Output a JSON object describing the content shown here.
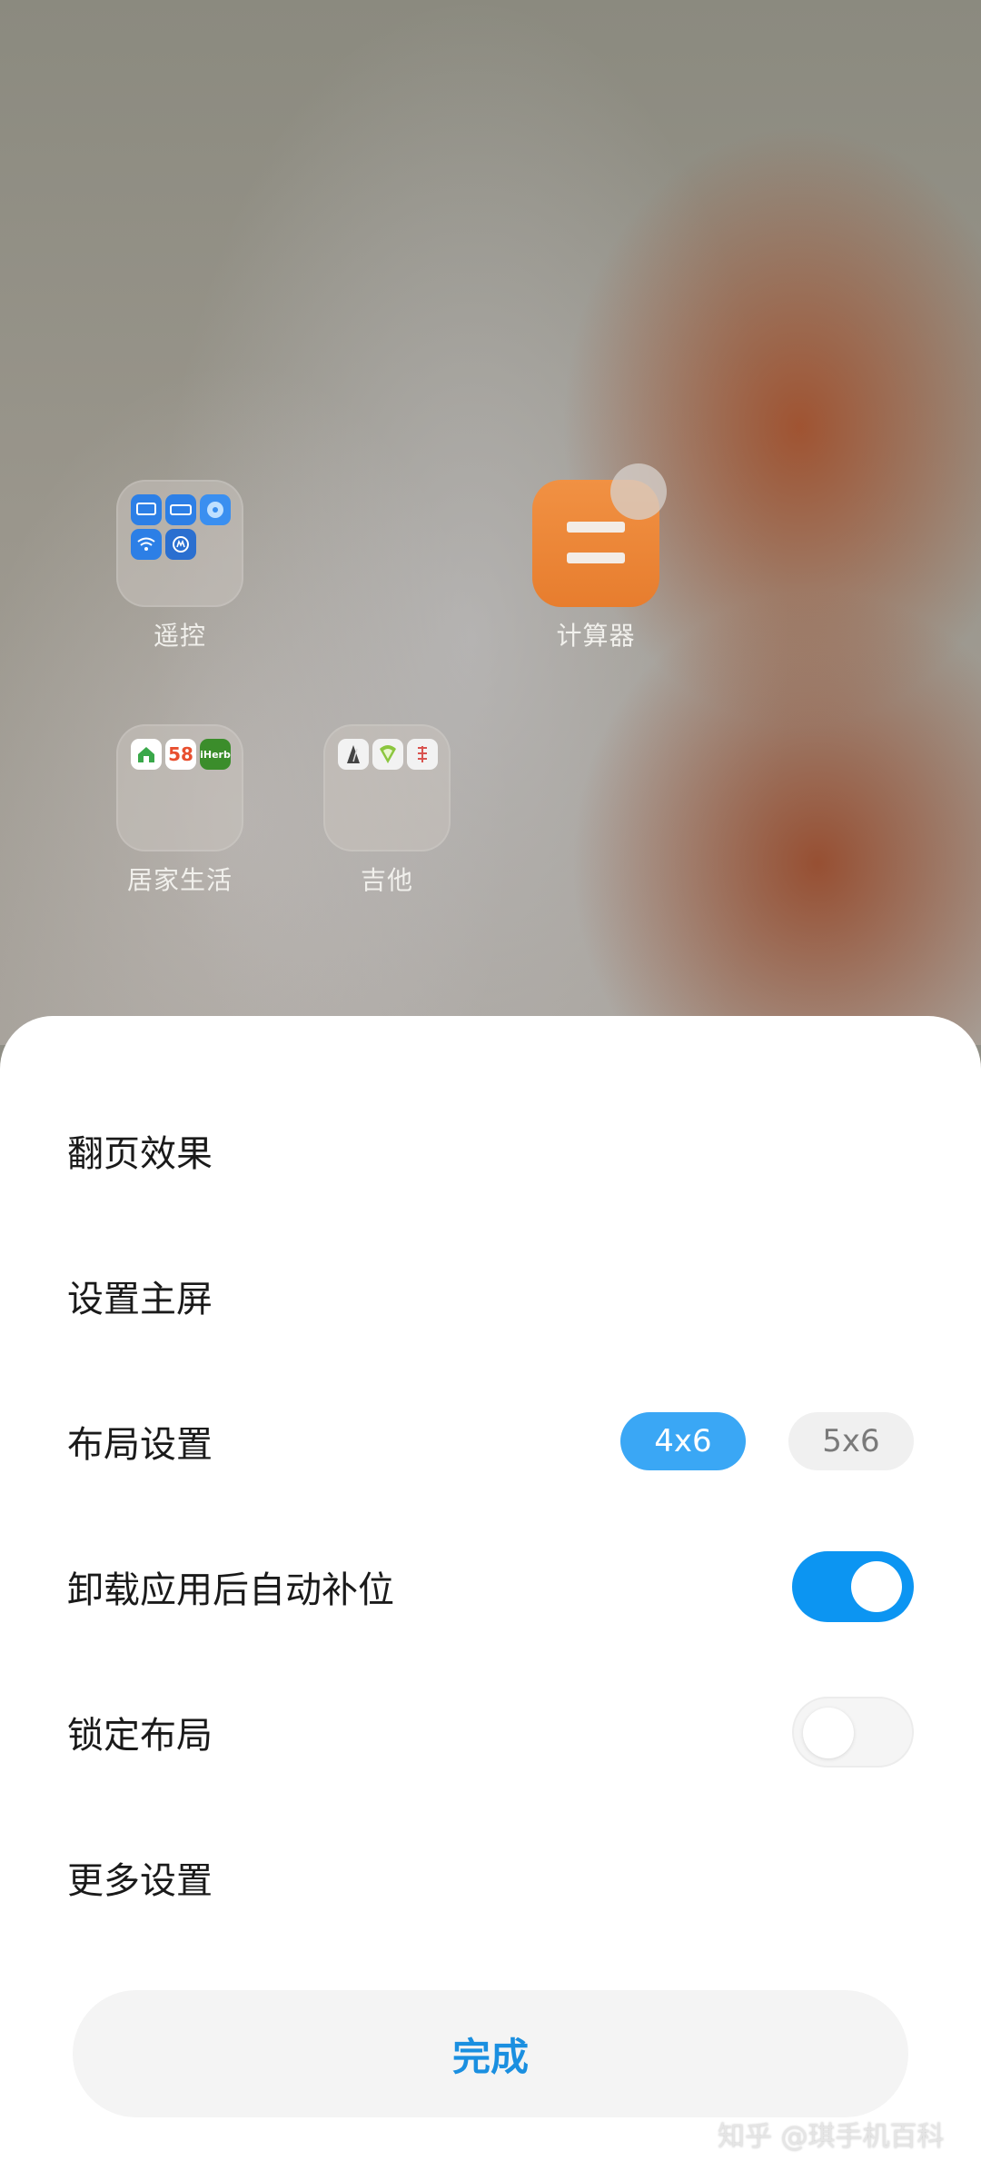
{
  "home": {
    "icons": [
      {
        "label": "遥控"
      },
      {
        "label": "计算器"
      },
      {
        "label": "居家生活"
      },
      {
        "label": "吉他"
      }
    ],
    "mini_58": "58",
    "mini_iherb": "iHerb"
  },
  "sheet": {
    "rows": [
      {
        "label": "翻页效果"
      },
      {
        "label": "设置主屏"
      },
      {
        "label": "布局设置"
      },
      {
        "label": "卸载应用后自动补位"
      },
      {
        "label": "锁定布局"
      },
      {
        "label": "更多设置"
      }
    ],
    "layout_options": [
      {
        "label": "4x6",
        "selected": true
      },
      {
        "label": "5x6",
        "selected": false
      }
    ],
    "auto_fill_enabled": true,
    "lock_layout_enabled": false,
    "done_label": "完成"
  },
  "watermark": "知乎 @琪手机百科",
  "colors": {
    "accent": "#0c95f2",
    "segment_selected": "#3aa7f5",
    "done_text": "#1a8fe0",
    "calculator": "#ef8a3c"
  }
}
